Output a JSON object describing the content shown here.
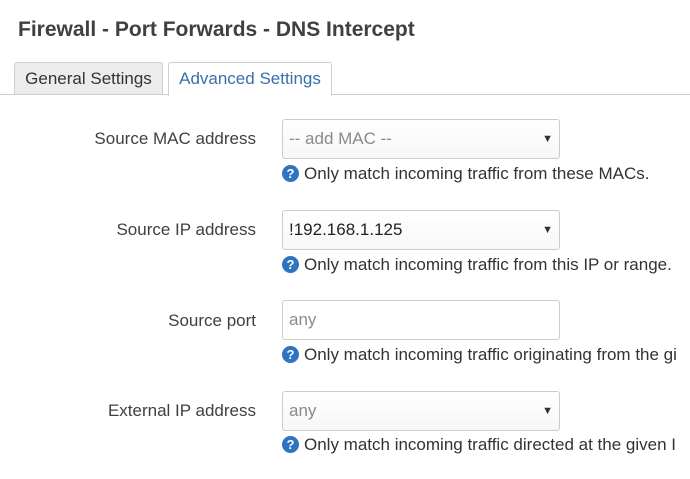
{
  "page": {
    "title": "Firewall - Port Forwards - DNS Intercept"
  },
  "tabs": [
    {
      "label": "General Settings"
    },
    {
      "label": "Advanced Settings"
    }
  ],
  "fields": {
    "source_mac": {
      "label": "Source MAC address",
      "value": "-- add MAC --",
      "hint": "Only match incoming traffic from these MACs."
    },
    "source_ip": {
      "label": "Source IP address",
      "value": "!192.168.1.125",
      "hint": "Only match incoming traffic from this IP or range."
    },
    "source_port": {
      "label": "Source port",
      "placeholder": "any",
      "hint": "Only match incoming traffic originating from the gi"
    },
    "external_ip": {
      "label": "External IP address",
      "value": "any",
      "hint": "Only match incoming traffic directed at the given I"
    }
  },
  "icons": {
    "help": "?",
    "caret": "▼"
  },
  "colors": {
    "accent": "#3a6fa8",
    "help_icon": "#2f74c0"
  }
}
